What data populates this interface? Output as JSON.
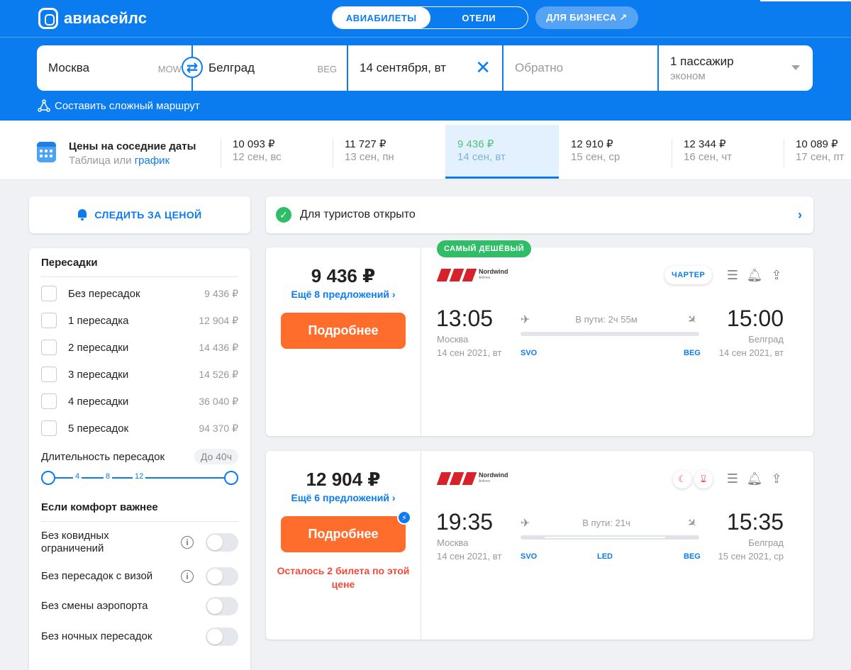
{
  "header": {
    "logo_text": "авиасейлс",
    "tabs": [
      {
        "label": "АВИАБИЛЕТЫ",
        "active": true
      },
      {
        "label": "ОТЕЛИ",
        "active": false
      }
    ],
    "business_label": "ДЛЯ БИЗНЕСА ↗",
    "accent": "#0b7cf0"
  },
  "search": {
    "from_city": "Москва",
    "from_code": "MOW",
    "to_city": "Белград",
    "to_code": "BEG",
    "depart_date": "14 сентября, вт",
    "return_placeholder": "Обратно",
    "passengers": "1 пассажир",
    "cabin": "эконом",
    "complex_route": "Составить сложный маршрут"
  },
  "dates": {
    "title": "Цены на соседние даты",
    "sub_table": "Таблица",
    "sub_or": " или ",
    "sub_chart": "график",
    "items": [
      {
        "price": "10 093 ₽",
        "date": "12 сен, вс"
      },
      {
        "price": "11 727 ₽",
        "date": "13 сен, пн"
      },
      {
        "price": "9 436 ₽",
        "date": "14 сен, вт",
        "selected": true
      },
      {
        "price": "12 910 ₽",
        "date": "15 сен, ср"
      },
      {
        "price": "12 344 ₽",
        "date": "16 сен, чт"
      },
      {
        "price": "10 089 ₽",
        "date": "17 сен, пт"
      }
    ]
  },
  "watch_label": "СЛЕДИТЬ ЗА ЦЕНОЙ",
  "tourist_open": "Для туристов открыто",
  "filters": {
    "transfers_title": "Пересадки",
    "transfers": [
      {
        "label": "Без пересадок",
        "price": "9 436 ₽"
      },
      {
        "label": "1 пересадка",
        "price": "12 904 ₽"
      },
      {
        "label": "2 пересадки",
        "price": "14 436 ₽"
      },
      {
        "label": "3 пересадки",
        "price": "14 526 ₽"
      },
      {
        "label": "4 пересадки",
        "price": "36 040 ₽"
      },
      {
        "label": "5 пересадок",
        "price": "94 370 ₽"
      }
    ],
    "duration_label": "Длительность пересадок",
    "duration_value": "До 40ч",
    "slider_ticks": [
      "4",
      "8",
      "12"
    ],
    "comfort_title": "Если комфорт важнее",
    "toggles": [
      {
        "label": "Без ковидных ограничений",
        "info": true
      },
      {
        "label": "Без пересадок с визой",
        "info": true
      },
      {
        "label": "Без смены аэропорта",
        "info": false
      },
      {
        "label": "Без ночных пересадок",
        "info": false
      }
    ]
  },
  "cheapest_badge": "САМЫЙ ДЕШЁВЫЙ",
  "tickets": [
    {
      "price": "9 436 ₽",
      "offers": "Ещё 8 предложений",
      "button": "Подробнее",
      "airline": "Nordwind",
      "airline_sub": "Airlines",
      "charter": "ЧАРТЕР",
      "dep_time": "13:05",
      "dep_city": "Москва",
      "dep_date": "14 сен 2021, вт",
      "arr_time": "15:00",
      "arr_city": "Белград",
      "arr_date": "14 сен 2021, вт",
      "duration": "В пути: 2ч 55м",
      "dep_code": "SVO",
      "arr_code": "BEG"
    },
    {
      "price": "12 904 ₽",
      "offers": "Ещё 6 предложений",
      "button": "Подробнее",
      "warning": "Осталось 2 билета по этой цене",
      "airline": "Nordwind",
      "airline_sub": "Airlines",
      "dep_time": "19:35",
      "dep_city": "Москва",
      "dep_date": "14 сен 2021, вт",
      "arr_time": "15:35",
      "arr_city": "Белград",
      "arr_date": "15 сен 2021, ср",
      "duration": "В пути: 21ч",
      "dep_code": "SVO",
      "mid_code": "LED",
      "arr_code": "BEG"
    }
  ]
}
